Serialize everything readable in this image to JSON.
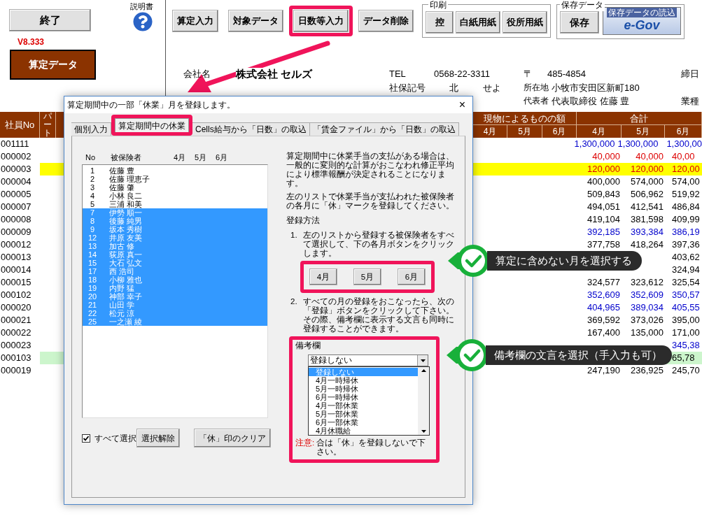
{
  "left_panel": {
    "exit_button": "終了",
    "manual_label": "説明書",
    "version": "V8.333",
    "data_button": "算定データ"
  },
  "toolbar": [
    {
      "label": "算定入力",
      "highlighted": false
    },
    {
      "label": "対象データ",
      "highlighted": false
    },
    {
      "label": "日数等入力",
      "highlighted": true
    },
    {
      "label": "データ削除",
      "highlighted": false
    }
  ],
  "print_group": {
    "legend": "印刷",
    "buttons": [
      "控",
      "白紙用紙",
      "役所用紙"
    ]
  },
  "save_group": {
    "legend": "保存データ",
    "save_button": "保存",
    "egov_caption": "保存データの読込",
    "egov_logo": "e-Gov"
  },
  "company": {
    "name_label": "会社名",
    "name": "株式会社 セルズ",
    "tel_label": "TEL",
    "tel": "0568-22-3311",
    "zip_label": "〒",
    "zip": "485-4854",
    "closing_label": "締日",
    "code_label": "社保記号",
    "code_1": "北",
    "code_2": "せよ",
    "address_label": "所在地",
    "address": "小牧市安田区新町180",
    "rep_label": "代表者",
    "rep": "代表取締役 佐藤 豊",
    "industry_label": "業種"
  },
  "table": {
    "employee_no": "社員No",
    "part": "パート",
    "groups": [
      {
        "label": "現物によるものの額",
        "months": [
          "4月",
          "5月",
          "6月"
        ]
      },
      {
        "label": "合計",
        "months": [
          "4月",
          "5月",
          "6月"
        ]
      }
    ],
    "rows": [
      {
        "no": "001111",
        "kind": "blue",
        "apr": "1,300,000",
        "may": "1,300,000",
        "jun": "1,300,00"
      },
      {
        "no": "000002",
        "kind": "red",
        "apr": "40,000",
        "may": "40,000",
        "jun": "40,00"
      },
      {
        "no": "000003",
        "kind": "red",
        "color": "#ffff00",
        "apr": "120,000",
        "may": "120,000",
        "jun": "120,00"
      },
      {
        "no": "000004",
        "kind": "plain",
        "apr": "400,000",
        "may": "574,000",
        "jun": "574,00"
      },
      {
        "no": "000005",
        "kind": "plain",
        "apr": "509,843",
        "may": "506,962",
        "jun": "519,92"
      },
      {
        "no": "000007",
        "kind": "plain",
        "apr": "494,051",
        "may": "412,541",
        "jun": "486,84"
      },
      {
        "no": "000008",
        "kind": "plain",
        "apr": "419,104",
        "may": "381,598",
        "jun": "409,99"
      },
      {
        "no": "000009",
        "kind": "blue",
        "apr": "392,185",
        "may": "393,384",
        "jun": "386,19"
      },
      {
        "no": "000012",
        "kind": "plain",
        "apr": "377,758",
        "may": "418,264",
        "jun": "397,36"
      },
      {
        "no": "000013",
        "kind": "plain",
        "jun": "403,62"
      },
      {
        "no": "000014",
        "kind": "plain",
        "jun": "324,94"
      },
      {
        "no": "000015",
        "kind": "plain",
        "apr": "324,577",
        "may": "323,612",
        "jun": "325,54"
      },
      {
        "no": "000102",
        "kind": "blue",
        "apr": "352,609",
        "may": "352,609",
        "jun": "350,57"
      },
      {
        "no": "000020",
        "kind": "blue",
        "apr": "404,965",
        "may": "389,034",
        "jun": "405,55"
      },
      {
        "no": "000021",
        "kind": "plain",
        "apr": "369,592",
        "may": "373,026",
        "jun": "395,00"
      },
      {
        "no": "000022",
        "kind": "plain",
        "apr": "167,400",
        "may": "135,000",
        "jun": "171,00"
      },
      {
        "no": "000023",
        "kind": "blue",
        "jun": "345,38"
      },
      {
        "no": "000103",
        "kind": "plain",
        "color": "#ccf5cc",
        "jun": "65,78"
      },
      {
        "no": "000019",
        "kind": "plain",
        "apr": "247,190",
        "may": "236,925",
        "jun": "245,70"
      }
    ]
  },
  "dialog": {
    "title": "算定期間中の一部「休業」月を登録します。",
    "close": "×",
    "tabs": [
      {
        "label": "個別入力",
        "selected": false,
        "highlighted": false
      },
      {
        "label": "算定期間中の休業",
        "selected": true,
        "highlighted": true
      },
      {
        "label": "Cells給与から「日数」の取込",
        "selected": false,
        "highlighted": false
      },
      {
        "label": "「賃金ファイル」から「日数」の取込",
        "selected": false,
        "highlighted": false
      }
    ],
    "list_header": {
      "no": "No",
      "name": "被保険者",
      "months": [
        "4月",
        "5月",
        "6月"
      ]
    },
    "people": [
      {
        "no": "1",
        "name": "佐藤 豊",
        "selected": false
      },
      {
        "no": "2",
        "name": "佐藤 理恵子",
        "selected": false
      },
      {
        "no": "3",
        "name": "佐藤 肇",
        "selected": false
      },
      {
        "no": "4",
        "name": "小林 良二",
        "selected": false
      },
      {
        "no": "5",
        "name": "三浦 和美",
        "selected": false
      },
      {
        "no": "7",
        "name": "伊勢 順一",
        "selected": true
      },
      {
        "no": "8",
        "name": "後藤 純男",
        "selected": true
      },
      {
        "no": "9",
        "name": "坂本 秀樹",
        "selected": true
      },
      {
        "no": "12",
        "name": "井原 友美",
        "selected": true
      },
      {
        "no": "13",
        "name": "加古 修",
        "selected": true
      },
      {
        "no": "14",
        "name": "荻原 真一",
        "selected": true
      },
      {
        "no": "15",
        "name": "大石 弘文",
        "selected": true
      },
      {
        "no": "17",
        "name": "西 浩司",
        "selected": true
      },
      {
        "no": "18",
        "name": "小柳 雅也",
        "selected": true
      },
      {
        "no": "19",
        "name": "内野 猛",
        "selected": true
      },
      {
        "no": "20",
        "name": "神部 幸子",
        "selected": true
      },
      {
        "no": "21",
        "name": "山田 学",
        "selected": true
      },
      {
        "no": "22",
        "name": "松元 涼",
        "selected": true
      },
      {
        "no": "25",
        "name": "一之瀬 綾",
        "selected": true
      }
    ],
    "select_all": {
      "label": "すべて選択",
      "checked": true
    },
    "buttons": [
      "選択解除",
      "「休」印のクリア"
    ],
    "intro": [
      "算定期間中に休業手当の支払がある場合は、一般的に変則的な計算がおこなわれ修正平均により標準報酬が決定されることになります。",
      "左のリストで休業手当が支払われた被保険者の各月に「休」マークを登録してください。"
    ],
    "method_heading": "登録方法",
    "steps": [
      {
        "number": "1.",
        "text": "左のリストから登録する被保険者をすべて選択して、下の各月ボタンをクリックします。"
      },
      {
        "number": "2.",
        "text": "すべての月の登録をおこなったら、次の「登録」ボタンをクリックして下さい。その際、備考欄に表示する文言も同時に登録することができます。"
      }
    ],
    "month_group": {
      "highlighted": true,
      "buttons": [
        "4月",
        "5月",
        "6月"
      ]
    },
    "remarks": {
      "highlighted": true,
      "label": "備考欄",
      "value": "登録しない",
      "options": [
        {
          "label": "登録しない",
          "selected": true
        },
        {
          "label": "4月一時帰休",
          "selected": false
        },
        {
          "label": "5月一時帰休",
          "selected": false
        },
        {
          "label": "6月一時帰休",
          "selected": false
        },
        {
          "label": "4月一部休業",
          "selected": false
        },
        {
          "label": "5月一部休業",
          "selected": false
        },
        {
          "label": "6月一部休業",
          "selected": false
        },
        {
          "label": "4月休職給",
          "selected": false
        }
      ]
    },
    "caution_label": "注意:",
    "caution_text": "合は「休」を登録しないで下さい。"
  },
  "callouts": [
    {
      "text": "算定に含めない月を選択する"
    },
    {
      "text": "備考欄の文言を選択（手入力も可）"
    }
  ]
}
